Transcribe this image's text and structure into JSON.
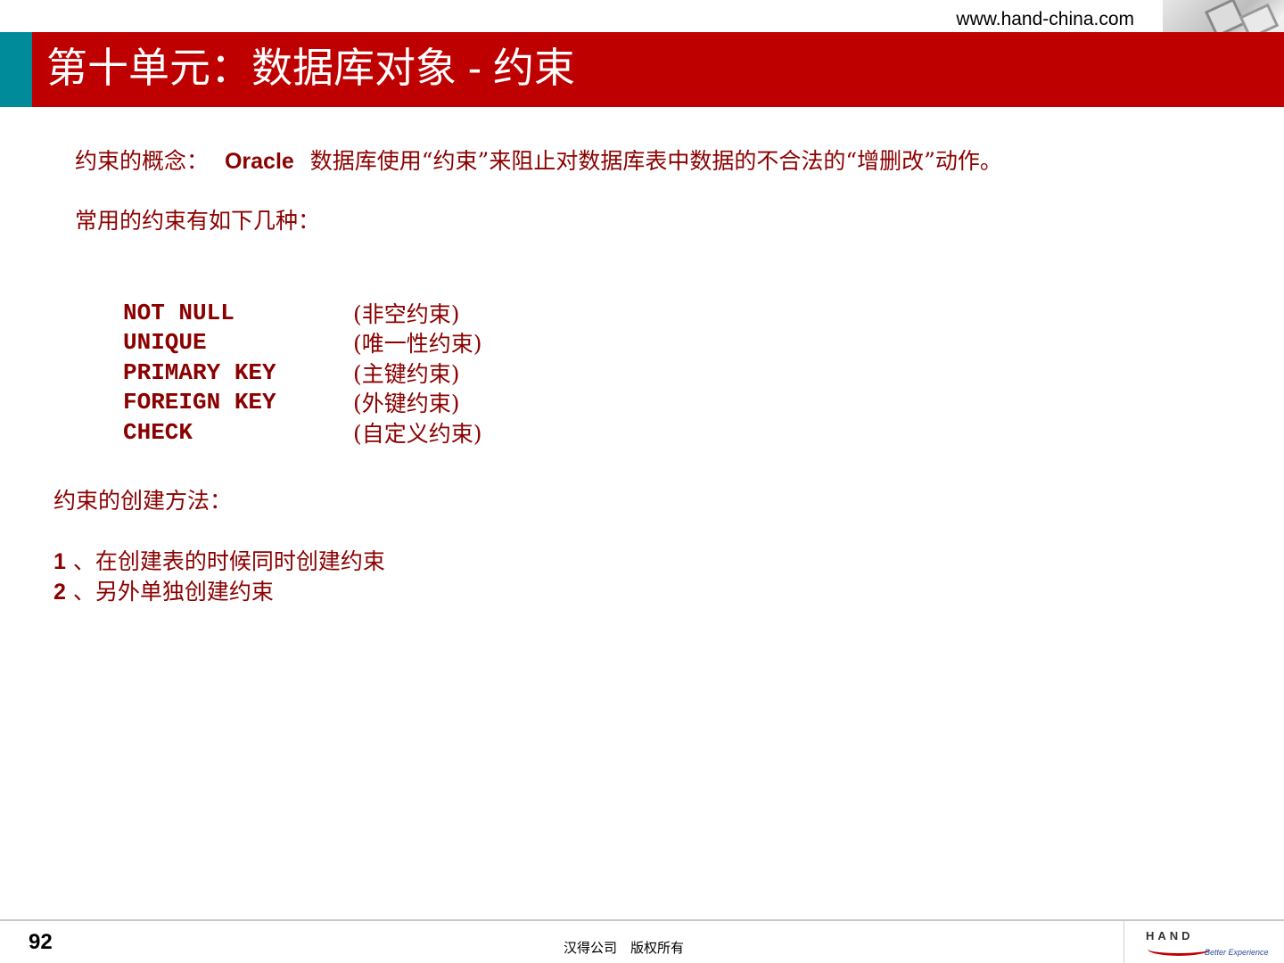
{
  "header": {
    "url": "www.hand-china.com",
    "title": "第十单元：数据库对象 - 约束"
  },
  "concept": {
    "label": "约束的概念：",
    "product": "Oracle",
    "text": "数据库使用“约束”来阻止对数据库表中数据的不合法的“增删改”动作。"
  },
  "common_intro": "常用的约束有如下几种：",
  "constraints": [
    {
      "code": "NOT NULL",
      "desc": "(非空约束)"
    },
    {
      "code": "UNIQUE",
      "desc": "(唯一性约束)"
    },
    {
      "code": "PRIMARY KEY",
      "desc": "(主键约束)"
    },
    {
      "code": "FOREIGN KEY",
      "desc": "(外键约束)"
    },
    {
      "code": "CHECK",
      "desc": "(自定义约束)"
    }
  ],
  "creation": {
    "heading": "约束的创建方法：",
    "methods": [
      {
        "num": "1",
        "text": "、在创建表的时候同时创建约束"
      },
      {
        "num": "2",
        "text": "、另外单独创建约束"
      }
    ]
  },
  "footer": {
    "page_number": "92",
    "copyright": "汉得公司　版权所有",
    "logo_text": "HAND",
    "logo_tagline": "Better Experience"
  },
  "colors": {
    "title_bar": "#bf0000",
    "accent_teal": "#008b9a",
    "body_text": "#8b0000"
  }
}
